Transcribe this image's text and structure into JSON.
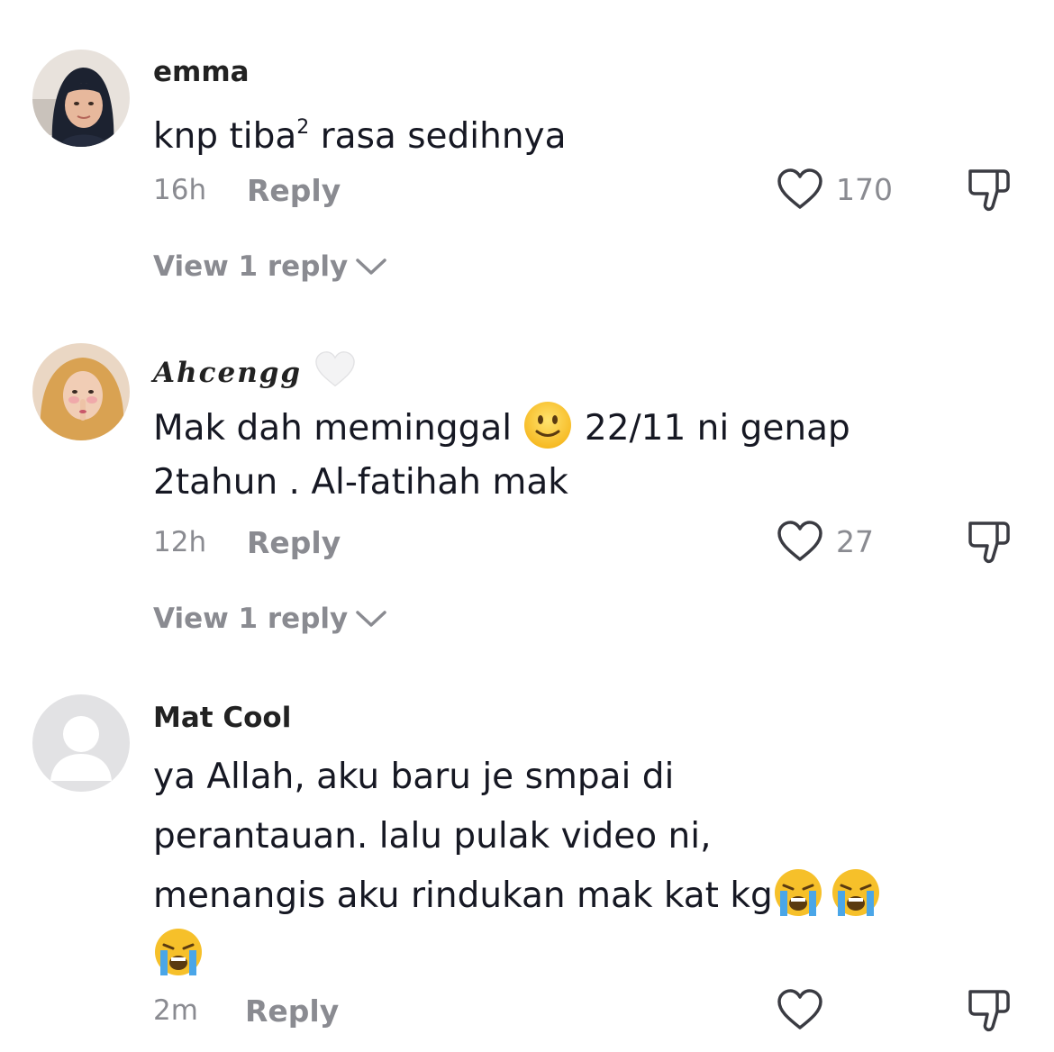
{
  "comments": [
    {
      "username": "emma",
      "text": "knp tiba",
      "text_sup": "2",
      "text_after": " rasa sedihnya",
      "time": "16h",
      "reply_label": "Reply",
      "likes": "170",
      "view_replies": "View 1 reply"
    },
    {
      "username": "Ahcengg",
      "text_1": "Mak dah meminggal ",
      "text_2": " 22/11 ni genap",
      "text_3": "2tahun . Al-fatihah mak",
      "time": "12h",
      "reply_label": "Reply",
      "likes": "27",
      "view_replies": "View 1 reply"
    },
    {
      "username": "Mat Cool",
      "text_1": "ya Allah, aku baru je smpai di",
      "text_2": "perantauan. lalu pulak video ni,",
      "text_3": "menangis aku rindukan mak kat kg",
      "time": "2m",
      "reply_label": "Reply"
    }
  ],
  "colors": {
    "text": "#161823",
    "muted": "#8a8b91",
    "background": "#ffffff"
  }
}
